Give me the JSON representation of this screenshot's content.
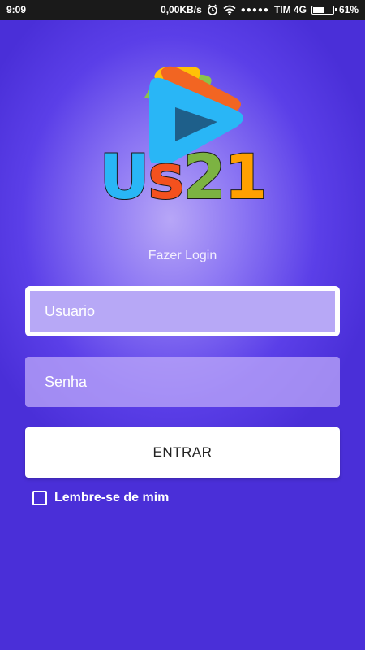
{
  "status_bar": {
    "time": "9:09",
    "network_speed": "0,00KB/s",
    "carrier": "TIM 4G",
    "battery": "61%",
    "battery_level": 0.61,
    "icons": [
      "alarm-icon",
      "wifi-icon",
      "signal-icon",
      "battery-icon"
    ]
  },
  "logo": {
    "text_parts": [
      "U",
      "s",
      "2",
      "1"
    ],
    "colors": {
      "u": "#29b6f6",
      "s": "#f4511e",
      "two": "#7cb342",
      "one": "#ffa000",
      "play_blue": "#29b6f6",
      "play_dark": "#1e5f8a",
      "back_orange": "#f26522",
      "back_green": "#8bc34a",
      "back_yellow": "#ffc107"
    }
  },
  "login": {
    "title": "Fazer Login",
    "username_placeholder": "Usuario",
    "password_placeholder": "Senha",
    "submit_label": "ENTRAR",
    "remember_label": "Lembre-se de mim"
  }
}
